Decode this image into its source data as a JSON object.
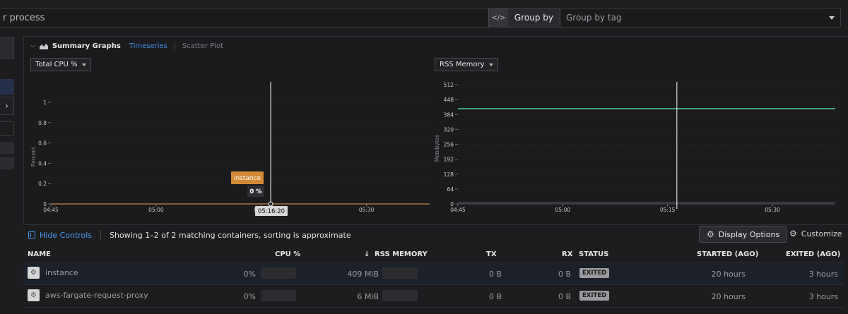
{
  "search": {
    "placeholder": "r process"
  },
  "groupby": {
    "label": "Group by",
    "placeholder": "Group by tag"
  },
  "left_rail": {
    "chevron": "›"
  },
  "summary": {
    "title": "Summary Graphs",
    "tabs": [
      "Timeseries",
      "Scatter Plot"
    ],
    "cpu_metric": "Total CPU %",
    "mem_metric": "RSS Memory"
  },
  "cpu_chart": {
    "ylabel": "Percent",
    "yticks": [
      "0",
      "0.2",
      "0.4",
      "0.6",
      "0.8",
      "1"
    ],
    "xticks": [
      "04:45",
      "05:00",
      "05:15",
      "05:30"
    ],
    "tooltip_series": "instance",
    "tooltip_value": "0 %",
    "cursor_time": "05:16:20"
  },
  "mem_chart": {
    "ylabel": "Mebibytes",
    "yticks": [
      "0",
      "64",
      "128",
      "192",
      "256",
      "320",
      "384",
      "448",
      "512"
    ],
    "xticks": [
      "04:45",
      "05:00",
      "05:15",
      "05:30"
    ]
  },
  "chart_data": [
    {
      "type": "line",
      "ylabel": "Percent",
      "ylim": [
        0,
        1
      ],
      "x_range": [
        "04:45",
        "05:39"
      ],
      "series": [
        {
          "name": "instance",
          "values": [
            0,
            0
          ],
          "x": [
            "04:45",
            "05:39"
          ],
          "color": "#e3a243"
        }
      ],
      "cursor_time": "05:16:20"
    },
    {
      "type": "line",
      "ylabel": "Mebibytes",
      "ylim": [
        0,
        512
      ],
      "x_range": [
        "04:45",
        "05:39"
      ],
      "series": [
        {
          "values": [
            409,
            409
          ],
          "x": [
            "04:45",
            "05:39"
          ],
          "color": "#4dcf9b"
        },
        {
          "values": [
            6,
            6
          ],
          "x": [
            "04:45",
            "05:39"
          ],
          "color": "#5a5a62"
        }
      ],
      "cursor_time": "05:16:20"
    }
  ],
  "controls": {
    "hide_label": "Hide Controls",
    "showing": "Showing 1–2 of 2 matching containers, sorting is approximate",
    "display_options": "Display Options",
    "customize": "Customize"
  },
  "table": {
    "headers": {
      "name": "NAME",
      "cpu": "CPU %",
      "mem": "RSS MEMORY",
      "tx": "TX",
      "rx": "RX",
      "status": "STATUS",
      "started": "STARTED (AGO)",
      "exited": "EXITED (AGO)"
    },
    "sort_icon": "↓",
    "rows": [
      {
        "name": "instance",
        "cpu": "0%",
        "mem": "409 MiB",
        "tx": "0 B",
        "rx": "0 B",
        "status": "EXITED",
        "started": "20 hours",
        "exited": "3 hours"
      },
      {
        "name": "aws-fargate-request-proxy",
        "cpu": "0%",
        "mem": "6 MiB",
        "tx": "0 B",
        "rx": "0 B",
        "status": "EXITED",
        "started": "20 hours",
        "exited": "3 hours"
      }
    ]
  },
  "colors": {
    "accent": "#3f8fe6",
    "tooltip": "#d38a36",
    "memory_line": "#4dcf9b"
  }
}
